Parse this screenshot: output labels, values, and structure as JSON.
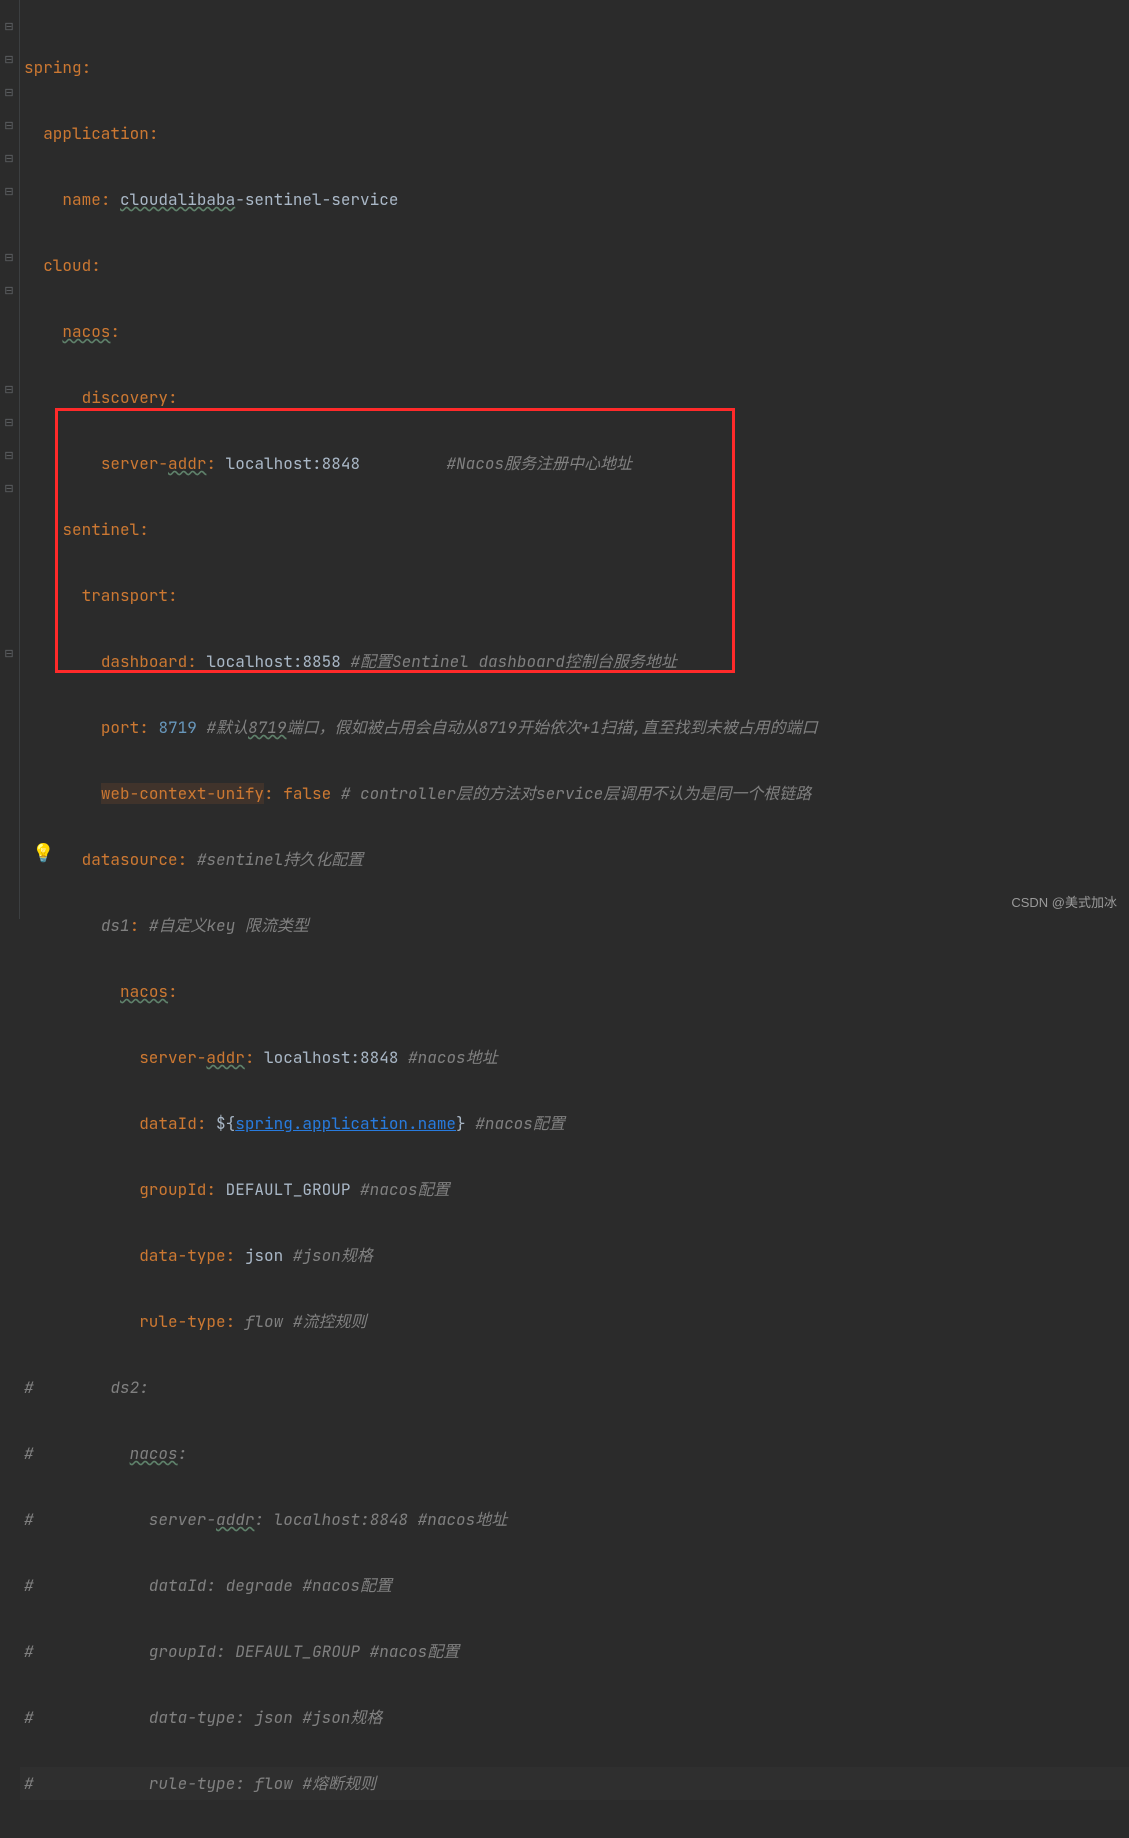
{
  "watermark": "CSDN @美式加冰",
  "lines": {
    "l1_key": "spring",
    "l2_key": "application",
    "l3_key": "name",
    "l3_val1": "cloudalibaba",
    "l3_val2": "-sentinel-service",
    "l4_key": "cloud",
    "l5_key": "nacos",
    "l6_key": "discovery",
    "l7_key": "server-",
    "l7_key2": "addr",
    "l7_val": "localhost:8848",
    "l7_comment": "#Nacos服务注册中心地址",
    "l8_key": "sentinel",
    "l9_key": "transport",
    "l10_key": "dashboard",
    "l10_val": "localhost:8858",
    "l10_comment": "#配置Sentinel dashboard控制台服务地址",
    "l11_key": "port",
    "l11_val": "8719",
    "l11_comment_a": "#默认",
    "l11_comment_b": "8719",
    "l11_comment_c": "端口，假如被占用会自动从8719开始依次+1扫描,直至找到未被占用的端口",
    "l12_key": "web-context-unify",
    "l12_val": "false",
    "l12_comment": "# controller层的方法对service层调用不认为是同一个根链路",
    "l13_key": "datasource",
    "l13_comment": "#sentinel持久化配置",
    "l14_key": "ds1",
    "l14_comment": "#自定义key 限流类型",
    "l15_key": "nacos",
    "l16_key": "server-",
    "l16_key2": "addr",
    "l16_val": "localhost:8848",
    "l16_comment": "#nacos地址",
    "l17_key": "dataId",
    "l17_val1": "${",
    "l17_val2": "spring.application.name",
    "l17_val3": "}",
    "l17_comment": "#nacos配置",
    "l18_key": "groupId",
    "l18_val": "DEFAULT_GROUP",
    "l18_comment": "#nacos配置",
    "l19_key": "data-type",
    "l19_val": "json",
    "l19_comment": "#json规格",
    "l20_key": "rule-type",
    "l20_val": "flow",
    "l20_comment": "#流控规则",
    "l21": "#        ds2:",
    "l22_a": "#          ",
    "l22_b": "nacos",
    "l22_c": ":",
    "l23_a": "#            server-",
    "l23_b": "addr",
    "l23_c": ": localhost:8848 #nacos地址",
    "l24": "#            dataId: degrade #nacos配置",
    "l25": "#            groupId: DEFAULT_GROUP #nacos配置",
    "l26": "#            data-type: json #json规格",
    "l27": "#            rule-type: flow #熔断规则"
  }
}
